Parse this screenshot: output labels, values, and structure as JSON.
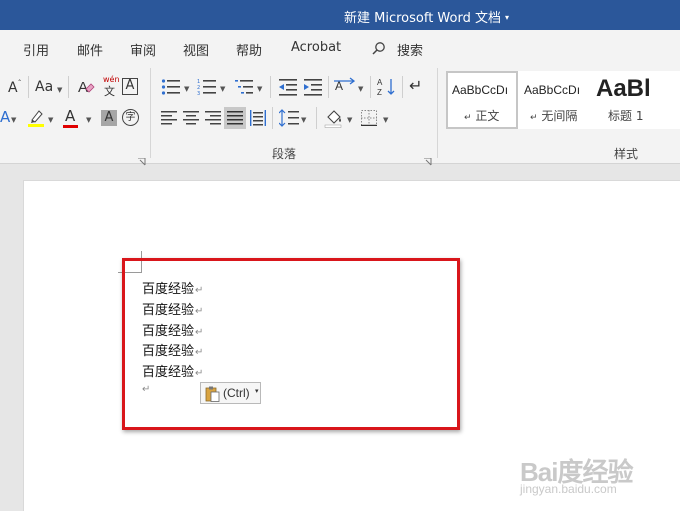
{
  "titlebar": {
    "title": "新建 Microsoft Word 文档",
    "caret": "▾",
    "color": "#2b579a"
  },
  "menu": {
    "tabs": [
      "引用",
      "邮件",
      "审阅",
      "视图",
      "帮助",
      "Acrobat"
    ],
    "search_label": "搜索"
  },
  "ribbon": {
    "font_group": {
      "grow_font": "A",
      "case_label": "Aa",
      "phonetic_top": "wén",
      "phonetic_bottom": "文",
      "char_border": "A",
      "text_effect": "A",
      "char_shading": "A",
      "enclose": "字",
      "highlight_color": "#ffff00",
      "font_color": "#e00000"
    },
    "paragraph_group": {
      "label": "段落",
      "sort_az": "A",
      "sort_za": "Z"
    },
    "styles_group": {
      "label": "样式",
      "styles": [
        {
          "sample": "AaBbCcDı",
          "name": "正文",
          "marker": "↵"
        },
        {
          "sample": "AaBbCcDı",
          "name": "无间隔",
          "marker": "↵"
        },
        {
          "sample": "AaBl",
          "name": "标题 1"
        }
      ]
    }
  },
  "document": {
    "lines": [
      "百度经验",
      "百度经验",
      "百度经验",
      "百度经验",
      "百度经验"
    ],
    "para_mark": "↵",
    "paste_options": {
      "label": "(Ctrl)",
      "caret": "▾"
    },
    "highlight_color": "#d9161b"
  },
  "watermark": {
    "main": "Bai度经验",
    "sub": "jingyan.baidu.com"
  }
}
